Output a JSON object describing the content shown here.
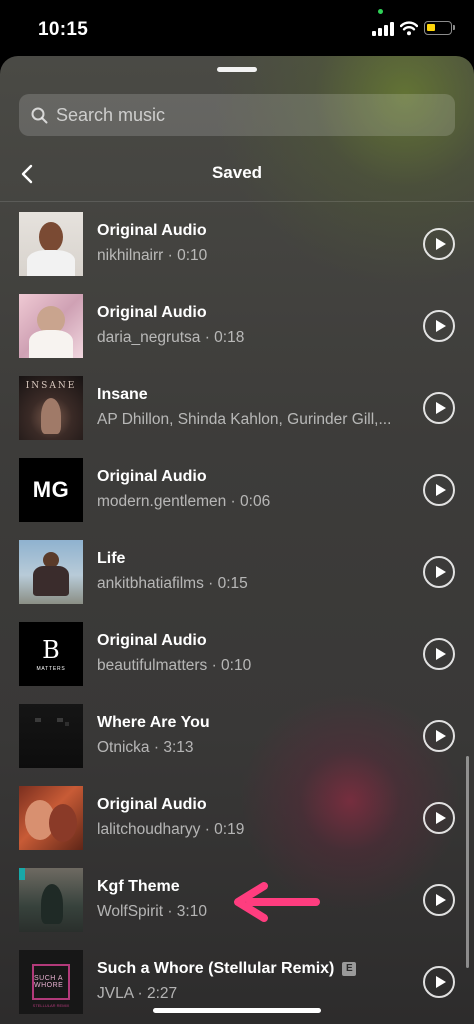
{
  "status_bar": {
    "time": "10:15",
    "battery_color": "#ffd60a"
  },
  "search": {
    "placeholder": "Search music",
    "icon": "search-icon"
  },
  "header": {
    "title": "Saved",
    "back_icon": "chevron-left-icon"
  },
  "tracks": [
    {
      "title": "Original Audio",
      "subtitle": "nikhilnairr · 0:10",
      "explicit": false
    },
    {
      "title": "Original Audio",
      "subtitle": "daria_negrutsa · 0:18",
      "explicit": false
    },
    {
      "title": "Insane",
      "subtitle": "AP Dhillon, Shinda Kahlon, Gurinder Gill,...",
      "explicit": false,
      "art_text": "INSANE"
    },
    {
      "title": "Original Audio",
      "subtitle": "modern.gentlemen · 0:06",
      "explicit": false,
      "art_text": "MG"
    },
    {
      "title": "Life",
      "subtitle": "ankitbhatiafilms · 0:15",
      "explicit": false
    },
    {
      "title": "Original Audio",
      "subtitle": "beautifulmatters · 0:10",
      "explicit": false,
      "art_text": "B",
      "art_subtext": "MATTERS"
    },
    {
      "title": "Where Are You",
      "subtitle": "Otnicka · 3:13",
      "explicit": false
    },
    {
      "title": "Original Audio",
      "subtitle": "lalitchoudharyy · 0:19",
      "explicit": false
    },
    {
      "title": "Kgf Theme",
      "subtitle": "WolfSpirit · 3:10",
      "explicit": false
    },
    {
      "title": "Such a Whore (Stellular Remix)",
      "subtitle": "JVLA · 2:27",
      "explicit": true,
      "explicit_label": "E",
      "art_text": "SUCH A WHORE",
      "art_subtext": "STELLULAR REMIX"
    }
  ],
  "annotation": {
    "arrow_color": "#ff3d7f"
  },
  "colors": {
    "accent_pink": "#ff3d7f",
    "status_green": "#30d158"
  }
}
